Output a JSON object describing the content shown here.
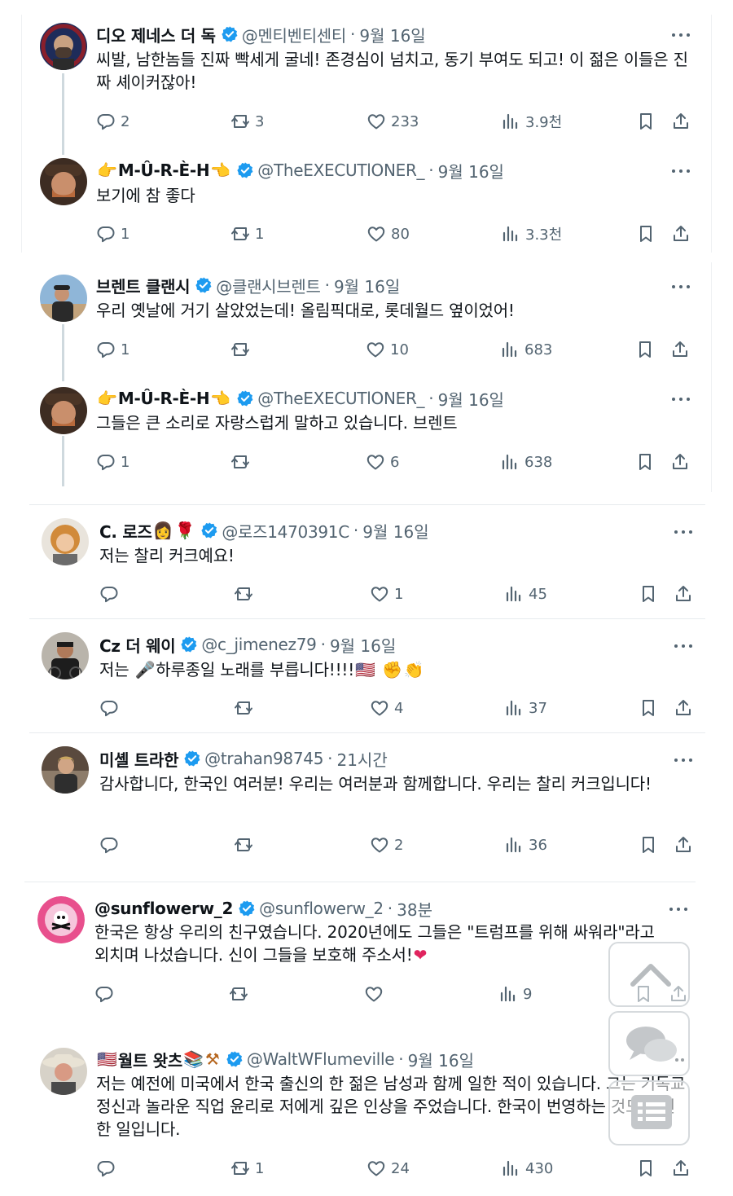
{
  "tweets": [
    {
      "name": "디오 제네스 더 독",
      "handle": "@멘티벤티센티",
      "time": "9월 16일",
      "text": "씨발, 남한놈들 진짜 빡세게 굴네! 존경심이 넘치고, 동기 부여도 되고! 이 젊은 이들은 진짜 셰이커잖아!",
      "replies": "2",
      "reposts": "3",
      "likes": "233",
      "views": "3.9천"
    },
    {
      "name": "M-Û-R-È-H",
      "handle": "@TheEXECUTlONER_",
      "time": "9월 16일",
      "text": "보기에 참 좋다",
      "replies": "1",
      "reposts": "1",
      "likes": "80",
      "views": "3.3천"
    },
    {
      "name": "브렌트 클랜시",
      "handle": "@클랜시브렌트",
      "time": "9월 16일",
      "text": "우리 옛날에 거기 살았었는데! 올림픽대로, 롯데월드 옆이었어!",
      "replies": "1",
      "reposts": "",
      "likes": "10",
      "views": "683"
    },
    {
      "name": "M-Û-R-È-H",
      "handle": "@TheEXECUTlONER_",
      "time": "9월 16일",
      "text": "그들은 큰 소리로 자랑스럽게 말하고 있습니다. 브렌트",
      "replies": "1",
      "reposts": "",
      "likes": "6",
      "views": "638"
    },
    {
      "name": "C. 로즈",
      "handle": "@로즈1470391C",
      "time": "9월 16일",
      "text": "저는 찰리 커크예요!",
      "replies": "",
      "reposts": "",
      "likes": "1",
      "views": "45"
    },
    {
      "name": "Cz 더 웨이",
      "handle": "@c_jimenez79",
      "time": "9월 16일",
      "text_a": "저는",
      "text_b": "하루종일 노래를 부릅니다!!!!",
      "replies": "",
      "reposts": "",
      "likes": "4",
      "views": "37"
    },
    {
      "name": "미셸 트라한",
      "handle": "@trahan98745",
      "time": "21시간",
      "text": "감사합니다, 한국인 여러분! 우리는 여러분과 함께합니다. 우리는 찰리 커크입니다!",
      "replies": "",
      "reposts": "",
      "likes": "2",
      "views": "36"
    },
    {
      "name": "@sunflowerw_2",
      "handle": "@sunflowerw_2",
      "time": "38분",
      "text": "한국은 항상 우리의 친구였습니다. 2020년에도 그들은 \"트럼프를 위해 싸워라\"라고 외치며 나섰습니다. 신이 그들을 보호해 주소서!",
      "replies": "",
      "reposts": "",
      "likes": "",
      "views": "9"
    },
    {
      "name": "월트 왓츠",
      "handle": "@WaltWFlumeville",
      "time": "9월 16일",
      "text": "저는 예전에 미국에서 한국 출신의 한 젊은 남성과 함께 일한 적이 있습니다. 그는 기독교 정신과 놀라운 직업 윤리로 저에게 깊은 인상을 주었습니다. 한국이 번영하는 것도 당연한 일입니다.",
      "replies": "",
      "reposts": "1",
      "likes": "24",
      "views": "430"
    }
  ],
  "icons": [
    "reply-icon",
    "repost-icon",
    "like-icon",
    "views-icon",
    "bookmark-icon",
    "share-icon",
    "verified-icon",
    "more-icon",
    "scroll-top-icon",
    "chat-icon",
    "list-icon"
  ],
  "colors": {
    "verified": "#1d9bf0",
    "secondary_text": "#536471",
    "thread_line": "#cfd9de",
    "heart_emoji": "#e0245e"
  }
}
